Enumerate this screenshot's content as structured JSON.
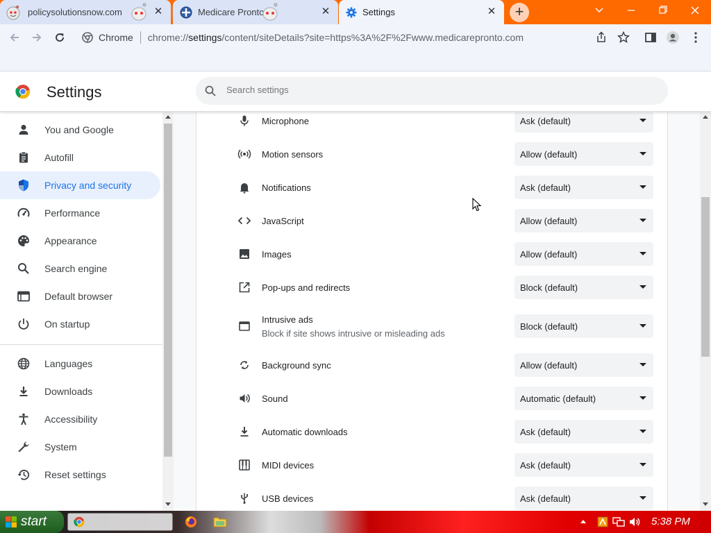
{
  "colors": {
    "tabstrip": "#ff6a00",
    "accent": "#1a73e8",
    "nav_selected_bg": "#e8f0fe",
    "select_bg": "#f1f3f4"
  },
  "tabs": [
    {
      "title": "policysolutionsnow.com",
      "icon": "reddit-alien-icon",
      "close": "✕"
    },
    {
      "title": "Medicare Pronto",
      "icon": "medicare-pronto-icon",
      "close": "✕"
    },
    {
      "title": "Settings",
      "icon": "gear-icon",
      "close": "✕",
      "active": true
    }
  ],
  "toolbar": {
    "site_label": "Chrome",
    "url_prefix": "chrome://",
    "url_host": "settings",
    "url_rest": "/content/siteDetails?site=https%3A%2F%2Fwww.medicarepronto.com"
  },
  "header": {
    "title": "Settings",
    "search_placeholder": "Search settings"
  },
  "sidebar": {
    "items": [
      {
        "label": "You and Google",
        "icon": "person-icon"
      },
      {
        "label": "Autofill",
        "icon": "clipboard-icon"
      },
      {
        "label": "Privacy and security",
        "icon": "shield-icon",
        "selected": true
      },
      {
        "label": "Performance",
        "icon": "speedometer-icon"
      },
      {
        "label": "Appearance",
        "icon": "palette-icon"
      },
      {
        "label": "Search engine",
        "icon": "search-icon"
      },
      {
        "label": "Default browser",
        "icon": "browser-window-icon"
      },
      {
        "label": "On startup",
        "icon": "power-icon"
      },
      {
        "label": "Languages",
        "icon": "globe-icon"
      },
      {
        "label": "Downloads",
        "icon": "download-icon"
      },
      {
        "label": "Accessibility",
        "icon": "accessibility-icon"
      },
      {
        "label": "System",
        "icon": "wrench-icon"
      },
      {
        "label": "Reset settings",
        "icon": "history-icon"
      }
    ]
  },
  "permissions": [
    {
      "name": "Microphone",
      "icon": "microphone-icon",
      "value": "Ask (default)"
    },
    {
      "name": "Motion sensors",
      "icon": "sensors-icon",
      "value": "Allow (default)"
    },
    {
      "name": "Notifications",
      "icon": "bell-icon",
      "value": "Ask (default)"
    },
    {
      "name": "JavaScript",
      "icon": "code-icon",
      "value": "Allow (default)"
    },
    {
      "name": "Images",
      "icon": "image-icon",
      "value": "Allow (default)"
    },
    {
      "name": "Pop-ups and redirects",
      "icon": "open-in-new-icon",
      "value": "Block (default)"
    },
    {
      "name": "Intrusive ads",
      "description": "Block if site shows intrusive or misleading ads",
      "icon": "window-icon",
      "value": "Block (default)"
    },
    {
      "name": "Background sync",
      "icon": "sync-icon",
      "value": "Allow (default)"
    },
    {
      "name": "Sound",
      "icon": "volume-icon",
      "value": "Automatic (default)"
    },
    {
      "name": "Automatic downloads",
      "icon": "download-icon",
      "value": "Ask (default)"
    },
    {
      "name": "MIDI devices",
      "icon": "piano-icon",
      "value": "Ask (default)"
    },
    {
      "name": "USB devices",
      "icon": "usb-icon",
      "value": "Ask (default)"
    }
  ],
  "taskbar": {
    "start_label": "start",
    "clock": "5:38 PM"
  }
}
